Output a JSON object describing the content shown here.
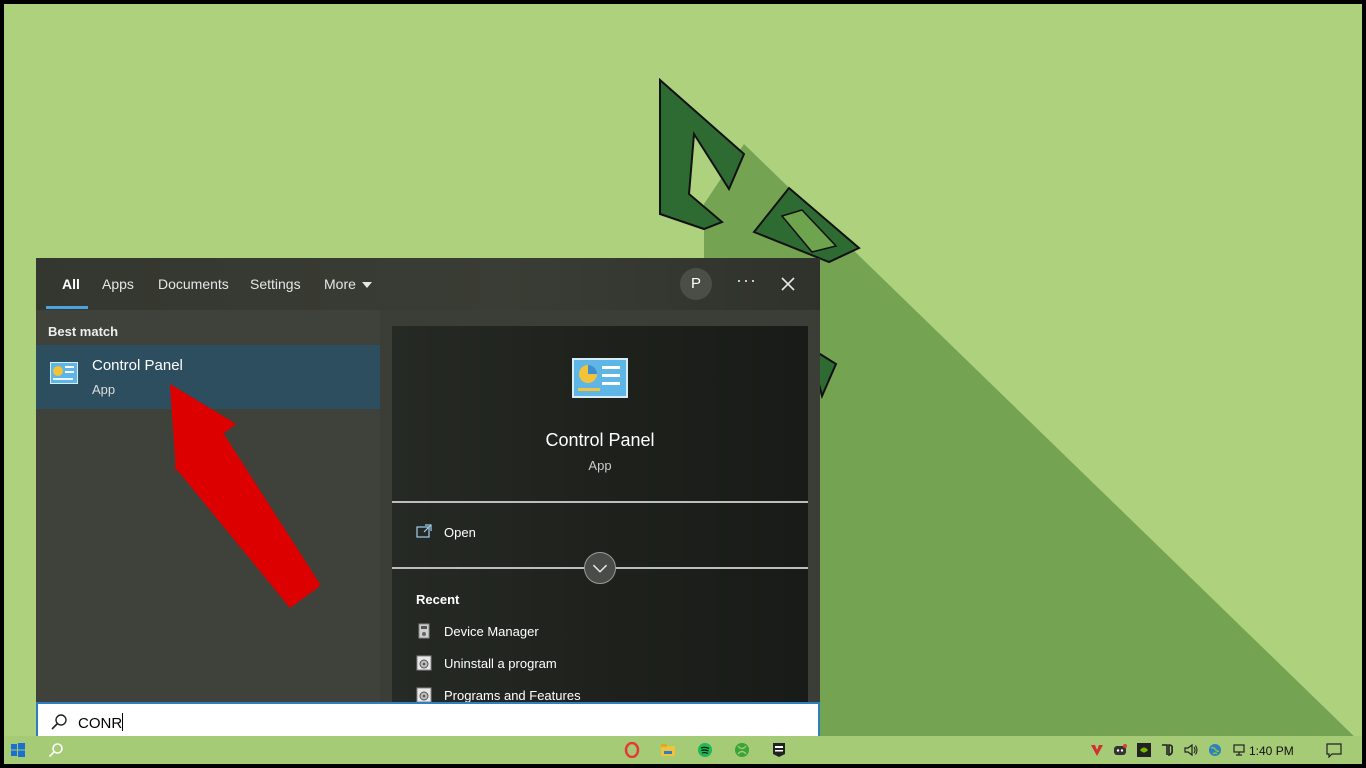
{
  "tabs": [
    {
      "label": "All",
      "active": true
    },
    {
      "label": "Apps"
    },
    {
      "label": "Documents"
    },
    {
      "label": "Settings"
    },
    {
      "label": "More"
    }
  ],
  "user_initial": "P",
  "more_options": "···",
  "best_match": {
    "section_label": "Best match",
    "name": "Control Panel",
    "type": "App"
  },
  "details": {
    "name": "Control Panel",
    "type": "App",
    "open_label": "Open",
    "recent_label": "Recent",
    "recent": [
      {
        "label": "Device Manager",
        "icon": "device-manager-icon"
      },
      {
        "label": "Uninstall a program",
        "icon": "programs-icon"
      },
      {
        "label": "Programs and Features",
        "icon": "programs-icon"
      }
    ]
  },
  "search": {
    "value": "CONR"
  },
  "taskbar": {
    "apps": [
      "opera-icon",
      "file-explorer-icon",
      "spotify-icon",
      "xbox-icon",
      "epic-games-icon"
    ],
    "clock": "1:40 PM"
  },
  "colors": {
    "wallpaper": "#aed17e",
    "accent": "#4aa3df",
    "selected": "#2c4e5f",
    "arrow": "#dd0000"
  }
}
